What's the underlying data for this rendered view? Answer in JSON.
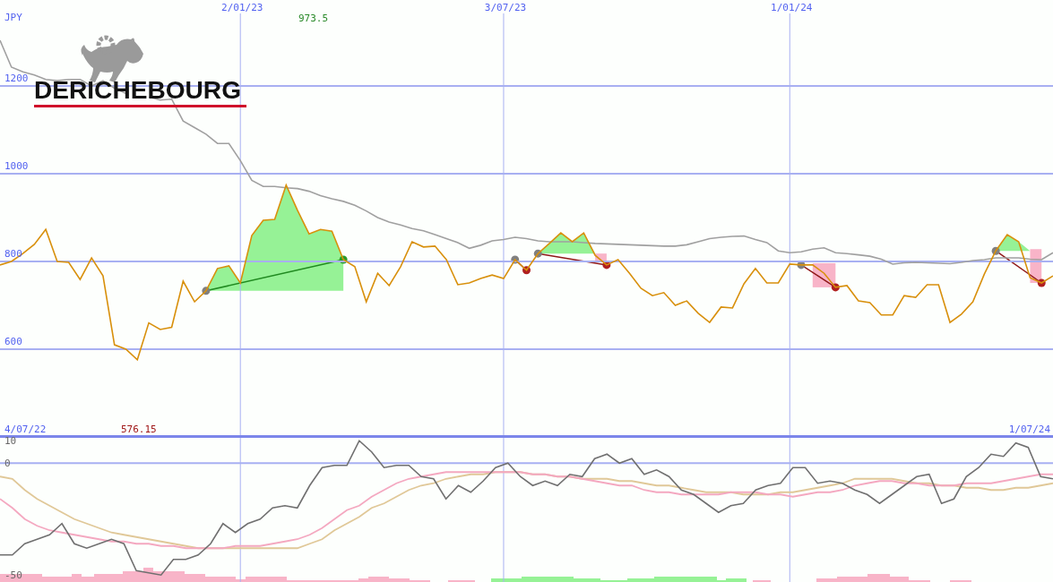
{
  "logo": {
    "name": "DERICHEBOURG"
  },
  "price_chart": {
    "currency": "JPY",
    "max_label": "973.5",
    "min_label": "576.15",
    "start_date": "4/07/22",
    "end_date": "1/07/24",
    "chart_data": {
      "type": "line",
      "categories": [
        null,
        null,
        null,
        null,
        null,
        null,
        null,
        null,
        null,
        null,
        null,
        null,
        null,
        null,
        null,
        null,
        null,
        null,
        null,
        null,
        null,
        "2/01/23",
        null,
        null,
        null,
        null,
        null,
        null,
        null,
        null,
        null,
        null,
        null,
        null,
        null,
        null,
        null,
        null,
        null,
        null,
        null,
        null,
        null,
        null,
        "3/07/23",
        null,
        null,
        null,
        null,
        null,
        null,
        null,
        null,
        null,
        null,
        null,
        null,
        null,
        null,
        null,
        null,
        null,
        null,
        null,
        null,
        null,
        null,
        null,
        null,
        "1/01/24",
        null,
        null,
        null,
        null,
        null,
        null,
        null,
        null,
        null,
        null,
        null,
        null,
        null,
        null,
        null,
        null,
        null,
        null,
        null,
        null,
        null,
        null,
        null
      ],
      "series": [
        {
          "color": "#d8900c",
          "values": [
            792,
            800,
            818,
            839,
            873,
            800,
            798,
            759,
            808,
            767,
            610,
            600,
            576,
            660,
            645,
            650,
            755,
            708,
            733,
            784,
            790,
            751,
            859,
            894,
            896,
            974,
            916,
            863,
            873,
            869,
            804,
            788,
            708,
            773,
            745,
            788,
            845,
            833,
            835,
            804,
            747,
            751,
            761,
            769,
            761,
            804,
            780,
            818,
            841,
            865,
            845,
            865,
            814,
            792,
            804,
            773,
            739,
            722,
            729,
            700,
            710,
            682,
            661,
            696,
            694,
            749,
            784,
            751,
            751,
            794,
            792,
            792,
            773,
            741,
            745,
            710,
            706,
            678,
            678,
            722,
            718,
            747,
            747,
            661,
            680,
            708,
            771,
            824,
            861,
            845,
            763,
            751,
            767
          ]
        },
        {
          "color": "#a0a0a0",
          "values": [
            1304,
            1243,
            1232,
            1225,
            1215,
            1212,
            1215,
            1215,
            1200,
            1212,
            1195,
            1183,
            null,
            1175,
            1168,
            1170,
            1120,
            1105,
            1090,
            1069,
            1069,
            1030,
            985,
            971,
            971,
            968,
            966,
            960,
            950,
            943,
            937,
            928,
            915,
            900,
            890,
            883,
            875,
            870,
            861,
            852,
            843,
            830,
            837,
            847,
            850,
            855,
            852,
            847,
            845,
            845,
            845,
            843,
            841,
            840,
            839,
            838,
            837,
            836,
            835,
            835,
            838,
            845,
            852,
            855,
            857,
            858,
            850,
            843,
            824,
            820,
            822,
            828,
            831,
            820,
            818,
            815,
            812,
            805,
            794,
            797,
            798,
            797,
            796,
            795,
            798,
            802,
            804,
            808,
            808,
            808,
            805,
            804,
            820
          ]
        }
      ],
      "yticks": [
        600,
        800,
        1000,
        1200
      ],
      "grid": true,
      "ylim": [
        404,
        1396
      ]
    }
  },
  "indicator_chart": {
    "chart_data": {
      "type": "line",
      "categories": [
        null,
        null,
        null,
        null,
        null,
        null,
        null,
        null,
        null,
        null,
        null,
        null,
        null,
        null,
        null,
        null,
        null,
        null,
        null,
        null,
        null,
        null,
        null,
        null,
        null,
        null,
        null,
        null,
        null,
        null,
        null,
        null,
        null,
        null,
        null,
        null,
        null,
        null,
        null,
        null,
        null,
        null,
        null,
        null,
        null,
        null,
        null,
        null,
        null,
        null,
        null,
        null,
        null,
        null,
        null,
        null,
        null,
        null,
        null,
        null,
        null,
        null,
        null,
        null,
        null,
        null,
        null,
        null,
        null,
        null,
        null,
        null,
        null,
        null,
        null,
        null,
        null,
        null,
        null,
        null,
        null,
        null,
        null,
        null,
        null,
        null
      ],
      "series": [
        {
          "color": "#707070",
          "values": [
            -41,
            -41,
            -36,
            -34,
            -32,
            -27,
            -36,
            -38,
            -36,
            -34,
            -36,
            -48,
            -49,
            -50,
            -43,
            -43,
            -41,
            -36,
            -27,
            -31,
            -27,
            -25,
            -20,
            -19,
            -20,
            -10,
            -2,
            -1,
            -1,
            10,
            5,
            -2,
            -1,
            -1,
            -6,
            -7,
            -16,
            -10,
            -13,
            -8,
            -2,
            0,
            -6,
            -10,
            -8,
            -10,
            -5,
            -6,
            2,
            4,
            0,
            2,
            -5,
            -3,
            -6,
            -12,
            -14,
            -18,
            -22,
            -19,
            -18,
            -12,
            -10,
            -9,
            -2,
            -2,
            -9,
            -8,
            -9,
            -12,
            -14,
            -18,
            -14,
            -10,
            -6,
            -5,
            -18,
            -16,
            -6,
            -2,
            4,
            3,
            9,
            7,
            -6,
            -7
          ]
        },
        {
          "color": "#f4a8c0",
          "values": [
            -16,
            -20,
            -25,
            -28,
            -30,
            -31,
            -32,
            -33,
            -34,
            -35,
            -35,
            -36,
            -36,
            -37,
            -37,
            -38,
            -38,
            -38,
            -38,
            -37,
            -37,
            -37,
            -36,
            -35,
            -34,
            -32,
            -29,
            -25,
            -21,
            -19,
            -15,
            -12,
            -9,
            -7,
            -6,
            -5,
            -4,
            -4,
            -4,
            -4,
            -4,
            -4,
            -4,
            -5,
            -5,
            -6,
            -6,
            -7,
            -8,
            -9,
            -10,
            -10,
            -12,
            -13,
            -13,
            -14,
            -14,
            -14,
            -14,
            -13,
            -13,
            -13,
            -14,
            -14,
            -15,
            -14,
            -13,
            -13,
            -12,
            -10,
            -9,
            -8,
            -8,
            -9,
            -9,
            -10,
            -10,
            -10,
            -9,
            -9,
            -9,
            -8,
            -7,
            -6,
            -5,
            -5
          ]
        },
        {
          "color": "#e0c898",
          "values": [
            -6,
            -7,
            -12,
            -16,
            -19,
            -22,
            -25,
            -27,
            -29,
            -31,
            -32,
            -33,
            -34,
            -35,
            -36,
            -37,
            -38,
            -38,
            -38,
            -38,
            -38,
            -38,
            -38,
            -38,
            -38,
            -36,
            -34,
            -30,
            -27,
            -24,
            -20,
            -18,
            -15,
            -12,
            -10,
            -9,
            -7,
            -6,
            -5,
            -5,
            -4,
            -4,
            -4,
            -5,
            -5,
            -6,
            -6,
            -7,
            -7,
            -7,
            -8,
            -8,
            -9,
            -10,
            -10,
            -11,
            -12,
            -13,
            -13,
            -13,
            -14,
            -14,
            -14,
            -13,
            -13,
            -12,
            -11,
            -10,
            -9,
            -7,
            -7,
            -7,
            -7,
            -8,
            -9,
            -9,
            -10,
            -10,
            -11,
            -11,
            -12,
            -12,
            -11,
            -11,
            -10,
            -9
          ]
        }
      ],
      "yticks": [
        10,
        0,
        -50
      ],
      "grid": true,
      "ylim": [
        -53.1,
        12.5
      ]
    }
  }
}
